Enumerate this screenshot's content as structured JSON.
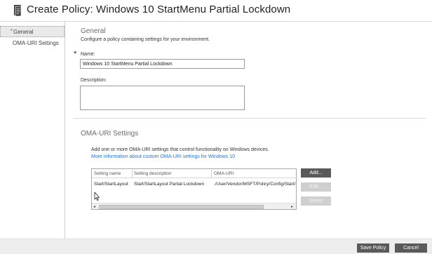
{
  "title": "Create Policy: Windows 10 StartMenu Partial Lockdown",
  "icons": {
    "title": "policy-document-icon",
    "cursor": "mouse-pointer-icon"
  },
  "sidebar": {
    "items": [
      {
        "label": "General",
        "required_marker": "*",
        "active": true
      },
      {
        "label": "OMA-URI Settings",
        "active": false
      }
    ]
  },
  "general": {
    "heading": "General",
    "description": "Configure a policy containing settings for your environment.",
    "name_required_marker": "*",
    "name_label": "Name:",
    "name_value": "Windows 10 StartMenu Partial Lockdown",
    "description_label": "Description:",
    "description_value": ""
  },
  "oma": {
    "heading": "OMA-URI Settings",
    "intro": "Add one or more OMA-URI settings that control functionality on Windows devices.",
    "link": "More information about custom OMA-URI settings for Windows 10",
    "columns": [
      "Setting name",
      "Setting description",
      "OMA-URI"
    ],
    "rows": [
      [
        "Start/StartLayout",
        "Start/StartLayout Partial Lockdown",
        "./User/Vendor/MSFT/Policy/Config/Start/StartLayout"
      ]
    ],
    "scroll_left": "◂",
    "scroll_right": "▸",
    "buttons": {
      "add": "Add...",
      "edit": "Edit...",
      "delete": "Delete"
    }
  },
  "footer": {
    "save": "Save Policy",
    "cancel": "Cancel"
  },
  "colors": {
    "button_dark": "#5a5a5a",
    "button_disabled": "#cfcfcf",
    "link": "#2a74c9",
    "footer_bg": "#eeeeee"
  }
}
